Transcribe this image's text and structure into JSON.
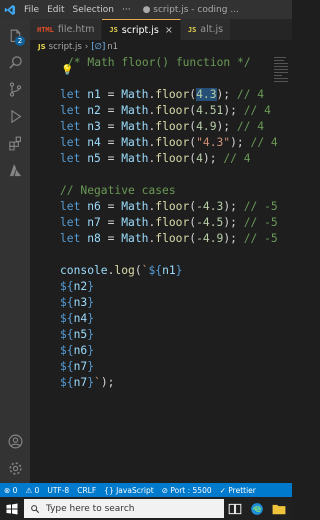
{
  "titlebar": {
    "menus": [
      "File",
      "Edit",
      "Selection",
      "···"
    ],
    "window_title": "● script.js - coding ..."
  },
  "activity": {
    "source_control_badge": "2"
  },
  "tabs": [
    {
      "icon": "HTML",
      "label": "file.htm",
      "active": false
    },
    {
      "icon": "JS",
      "label": "script.js",
      "active": true
    },
    {
      "icon": "JS",
      "label": "alt.js",
      "active": false
    }
  ],
  "tab_close": "×",
  "breadcrumb": {
    "file_icon": "JS",
    "file": "script.js",
    "separator": "›",
    "symbol_icon": "[∅]",
    "symbol": "n1"
  },
  "editor": {
    "lightbulb": "💡",
    "lines": [
      {
        "row": 0,
        "tokens": [
          {
            "t": "/* Math floor() function */",
            "c": "cmt"
          }
        ],
        "indent": 1
      },
      {
        "row": 2,
        "tokens": [
          {
            "t": "let ",
            "c": "kw"
          },
          {
            "t": "n1",
            "c": "var"
          },
          {
            "t": " = "
          },
          {
            "t": "Math",
            "c": "var"
          },
          {
            "t": "."
          },
          {
            "t": "floor",
            "c": "fn"
          },
          {
            "t": "("
          },
          {
            "t": "4.3",
            "c": "num hl"
          },
          {
            "t": "); "
          },
          {
            "t": "// 4",
            "c": "cmt"
          }
        ]
      },
      {
        "row": 3,
        "tokens": [
          {
            "t": "let ",
            "c": "kw"
          },
          {
            "t": "n2",
            "c": "var"
          },
          {
            "t": " = "
          },
          {
            "t": "Math",
            "c": "var"
          },
          {
            "t": "."
          },
          {
            "t": "floor",
            "c": "fn"
          },
          {
            "t": "("
          },
          {
            "t": "4.51",
            "c": "num"
          },
          {
            "t": "); "
          },
          {
            "t": "// 4",
            "c": "cmt"
          }
        ]
      },
      {
        "row": 4,
        "tokens": [
          {
            "t": "let ",
            "c": "kw"
          },
          {
            "t": "n3",
            "c": "var"
          },
          {
            "t": " = "
          },
          {
            "t": "Math",
            "c": "var"
          },
          {
            "t": "."
          },
          {
            "t": "floor",
            "c": "fn"
          },
          {
            "t": "("
          },
          {
            "t": "4.9",
            "c": "num"
          },
          {
            "t": "); "
          },
          {
            "t": "// 4",
            "c": "cmt"
          }
        ]
      },
      {
        "row": 5,
        "tokens": [
          {
            "t": "let ",
            "c": "kw"
          },
          {
            "t": "n4",
            "c": "var"
          },
          {
            "t": " = "
          },
          {
            "t": "Math",
            "c": "var"
          },
          {
            "t": "."
          },
          {
            "t": "floor",
            "c": "fn"
          },
          {
            "t": "("
          },
          {
            "t": "\"4.3\"",
            "c": "str"
          },
          {
            "t": "); "
          },
          {
            "t": "// 4",
            "c": "cmt"
          }
        ]
      },
      {
        "row": 6,
        "tokens": [
          {
            "t": "let ",
            "c": "kw"
          },
          {
            "t": "n5",
            "c": "var"
          },
          {
            "t": " = "
          },
          {
            "t": "Math",
            "c": "var"
          },
          {
            "t": "."
          },
          {
            "t": "floor",
            "c": "fn"
          },
          {
            "t": "("
          },
          {
            "t": "4",
            "c": "num"
          },
          {
            "t": "); "
          },
          {
            "t": "// 4",
            "c": "cmt"
          }
        ]
      },
      {
        "row": 8,
        "tokens": [
          {
            "t": "// Negative cases",
            "c": "cmt"
          }
        ]
      },
      {
        "row": 9,
        "tokens": [
          {
            "t": "let ",
            "c": "kw"
          },
          {
            "t": "n6",
            "c": "var"
          },
          {
            "t": " = "
          },
          {
            "t": "Math",
            "c": "var"
          },
          {
            "t": "."
          },
          {
            "t": "floor",
            "c": "fn"
          },
          {
            "t": "("
          },
          {
            "t": "-4.3",
            "c": "num"
          },
          {
            "t": "); "
          },
          {
            "t": "// -5",
            "c": "cmt"
          }
        ]
      },
      {
        "row": 10,
        "tokens": [
          {
            "t": "let ",
            "c": "kw"
          },
          {
            "t": "n7",
            "c": "var"
          },
          {
            "t": " = "
          },
          {
            "t": "Math",
            "c": "var"
          },
          {
            "t": "."
          },
          {
            "t": "floor",
            "c": "fn"
          },
          {
            "t": "("
          },
          {
            "t": "-4.5",
            "c": "num"
          },
          {
            "t": "); "
          },
          {
            "t": "// -5",
            "c": "cmt"
          }
        ]
      },
      {
        "row": 11,
        "tokens": [
          {
            "t": "let ",
            "c": "kw"
          },
          {
            "t": "n8",
            "c": "var"
          },
          {
            "t": " = "
          },
          {
            "t": "Math",
            "c": "var"
          },
          {
            "t": "."
          },
          {
            "t": "floor",
            "c": "fn"
          },
          {
            "t": "("
          },
          {
            "t": "-4.9",
            "c": "num"
          },
          {
            "t": "); "
          },
          {
            "t": "// -5",
            "c": "cmt"
          }
        ]
      },
      {
        "row": 13,
        "tokens": [
          {
            "t": "console",
            "c": "var"
          },
          {
            "t": "."
          },
          {
            "t": "log",
            "c": "fn"
          },
          {
            "t": "("
          },
          {
            "t": "`",
            "c": "str"
          },
          {
            "t": "${",
            "c": "kw"
          },
          {
            "t": "n1",
            "c": "var"
          },
          {
            "t": "}",
            "c": "kw"
          }
        ]
      },
      {
        "row": 14,
        "tokens": [
          {
            "t": "${",
            "c": "kw"
          },
          {
            "t": "n2",
            "c": "var"
          },
          {
            "t": "}",
            "c": "kw"
          }
        ]
      },
      {
        "row": 15,
        "tokens": [
          {
            "t": "${",
            "c": "kw"
          },
          {
            "t": "n3",
            "c": "var"
          },
          {
            "t": "}",
            "c": "kw"
          }
        ]
      },
      {
        "row": 16,
        "tokens": [
          {
            "t": "${",
            "c": "kw"
          },
          {
            "t": "n4",
            "c": "var"
          },
          {
            "t": "}",
            "c": "kw"
          }
        ]
      },
      {
        "row": 17,
        "tokens": [
          {
            "t": "${",
            "c": "kw"
          },
          {
            "t": "n5",
            "c": "var"
          },
          {
            "t": "}",
            "c": "kw"
          }
        ]
      },
      {
        "row": 18,
        "tokens": [
          {
            "t": "${",
            "c": "kw"
          },
          {
            "t": "n6",
            "c": "var"
          },
          {
            "t": "}",
            "c": "kw"
          }
        ]
      },
      {
        "row": 19,
        "tokens": [
          {
            "t": "${",
            "c": "kw"
          },
          {
            "t": "n7",
            "c": "var"
          },
          {
            "t": "}",
            "c": "kw"
          }
        ]
      },
      {
        "row": 20,
        "tokens": [
          {
            "t": "${",
            "c": "kw"
          },
          {
            "t": "n7",
            "c": "var"
          },
          {
            "t": "}",
            "c": "kw"
          },
          {
            "t": "`",
            "c": "str"
          },
          {
            "t": ");"
          }
        ]
      }
    ]
  },
  "statusbar": {
    "errors": "⊗ 0",
    "warnings": "⚠ 0",
    "encoding": "UTF-8",
    "eol": "CRLF",
    "language": "{} JavaScript",
    "port": "⊘ Port : 5500",
    "prettier": "✓ Prettier"
  },
  "taskbar": {
    "search_placeholder": "Type here to search"
  },
  "colors": {
    "accent": "#007acc",
    "editor_bg": "#1e1e1e",
    "activity_bg": "#333333"
  }
}
